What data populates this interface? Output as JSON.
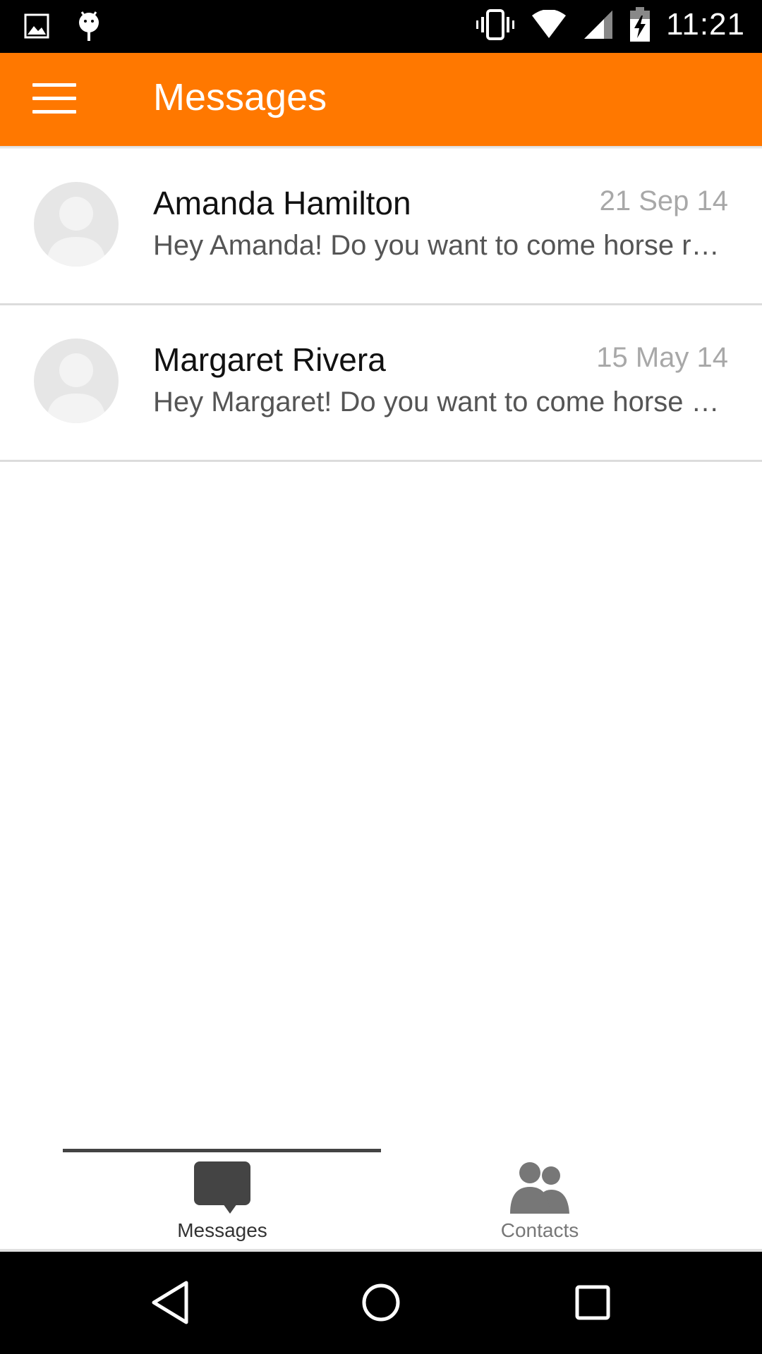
{
  "status_bar": {
    "time": "11:21",
    "icons": [
      "image-icon",
      "android-debug-icon",
      "vibrate-icon",
      "wifi-icon",
      "signal-icon",
      "battery-charging-icon"
    ]
  },
  "app_bar": {
    "title": "Messages",
    "menu_icon": "hamburger-menu-icon"
  },
  "conversations": [
    {
      "name": "Amanda Hamilton",
      "date": "21 Sep 14",
      "preview": "Hey Amanda! Do you want to come horse r…"
    },
    {
      "name": "Margaret Rivera",
      "date": "15 May 14",
      "preview": "Hey Margaret! Do you want to come horse …"
    }
  ],
  "tabs": [
    {
      "label": "Messages",
      "icon": "chat-bubble-icon",
      "selected": true
    },
    {
      "label": "Contacts",
      "icon": "people-icon",
      "selected": false
    }
  ],
  "nav_bar": {
    "icons": [
      "back-icon",
      "home-icon",
      "recents-icon"
    ]
  },
  "colors": {
    "accent": "#ff7800",
    "status_bar": "#000000",
    "nav_bar": "#000000"
  }
}
